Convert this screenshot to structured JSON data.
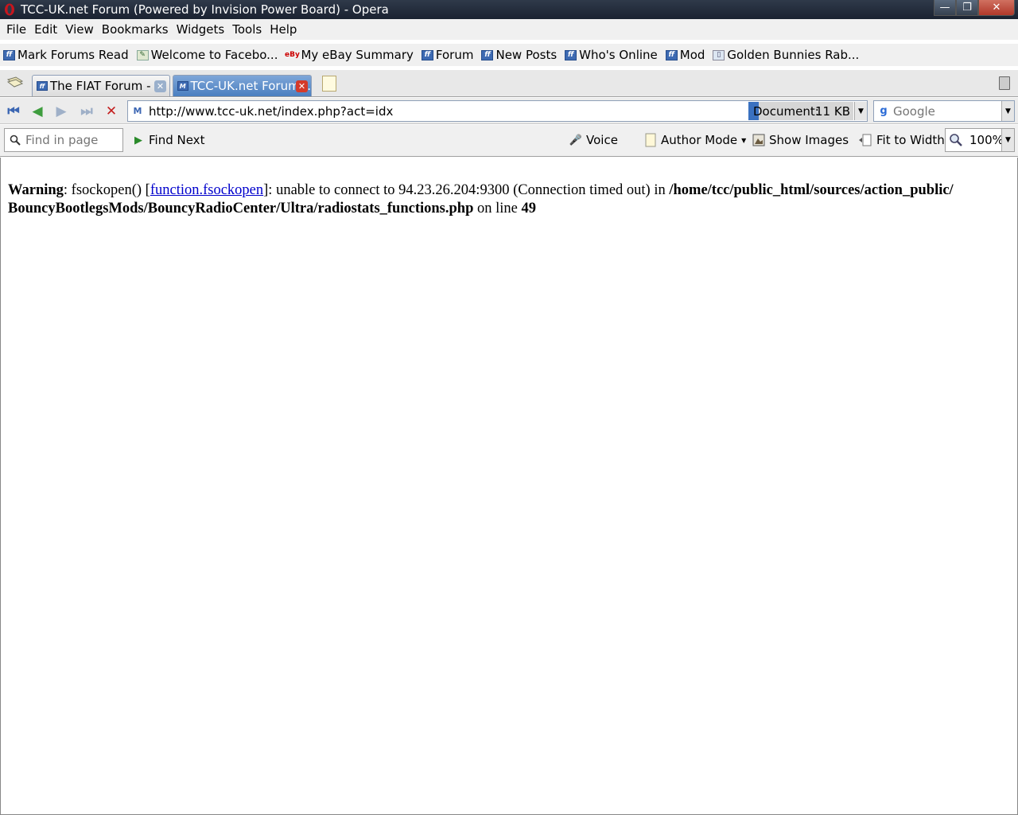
{
  "window": {
    "title": "TCC-UK.net Forum (Powered by Invision Power Board) - Opera",
    "minimize": "—",
    "maximize": "❐",
    "close": "✕"
  },
  "menu": [
    "File",
    "Edit",
    "View",
    "Bookmarks",
    "Widgets",
    "Tools",
    "Help"
  ],
  "bookmarks": [
    {
      "label": "Mark Forums Read",
      "icon": "forum-icon"
    },
    {
      "label": "Welcome to Facebo...",
      "icon": "facebook-icon"
    },
    {
      "label": "My eBay Summary",
      "icon": "ebay-icon"
    },
    {
      "label": "Forum",
      "icon": "forum-icon"
    },
    {
      "label": "New Posts",
      "icon": "forum-icon"
    },
    {
      "label": "Who's Online",
      "icon": "forum-icon"
    },
    {
      "label": "Mod",
      "icon": "forum-icon"
    },
    {
      "label": "Golden Bunnies Rab...",
      "icon": "page-icon"
    }
  ],
  "tabs": [
    {
      "label": "The FIAT Forum - ...",
      "active": false
    },
    {
      "label": "TCC-UK.net Forum...",
      "active": true
    }
  ],
  "navigation": {
    "url": "http://www.tcc-uk.net/index.php?act=idx",
    "progress_label": "Document:",
    "document_size": "11 KB",
    "progress_fraction": 0.1,
    "search_placeholder": "Google"
  },
  "viewbar": {
    "find_placeholder": "Find in page",
    "find_next": "Find Next",
    "voice": "Voice",
    "author_mode": "Author Mode",
    "show_images": "Show Images",
    "fit_to_width": "Fit to Width",
    "zoom": "100%"
  },
  "content": {
    "warning_label": "Warning",
    "text1": ": fsockopen() [",
    "link": "function.fsockopen",
    "text2": "]: unable to connect to 94.23.26.204:9300 (Connection timed out) in ",
    "path": "/home/tcc/public_html/sources/action_public/ BouncyBootlegsMods/BouncyRadioCenter/Ultra/radiostats_functions.php",
    "text3": " on line ",
    "line": "49"
  },
  "colors": {
    "active_tab": "#4a7fc0",
    "link": "#0000cc",
    "titlebar": "#1a2230"
  }
}
